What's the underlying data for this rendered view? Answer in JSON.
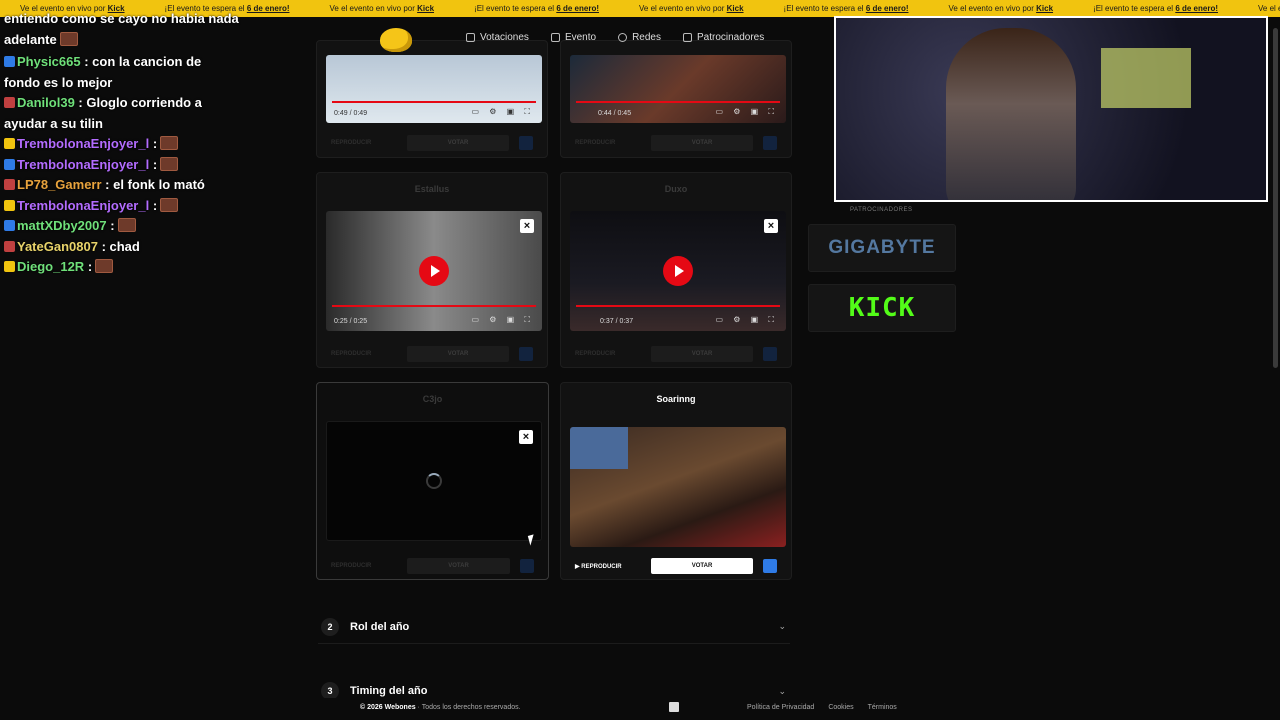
{
  "ticker": {
    "messages": [
      {
        "text": "Ve el evento en vivo por",
        "link": "Kick"
      },
      {
        "text": "¡El evento te espera el",
        "link": "6 de enero!"
      },
      {
        "text": "Ve el evento en vivo por",
        "link": "Kick"
      },
      {
        "text": "¡El evento te espera el",
        "link": "6 de enero!"
      },
      {
        "text": "Ve el evento en vivo por",
        "link": "Kick"
      },
      {
        "text": "¡El evento te espera el",
        "link": "6 de enero!"
      },
      {
        "text": "Ve el evento en vivo por",
        "link": "Kick"
      },
      {
        "text": "¡El evento te espera el",
        "link": "6 de enero!"
      },
      {
        "text": "Ve el evento en vivo por",
        "link": "Kick"
      }
    ]
  },
  "chat": {
    "top_line_1": "entiendo como se cayo no habia nada",
    "top_line_2": "adelante",
    "messages": [
      {
        "user": "Physic665",
        "user_color": "#6fe07a",
        "text": " : con la cancion de fondo es lo mejor"
      },
      {
        "user": "Danilol39",
        "user_color": "#6fe07a",
        "text": " : Gloglo corriendo a ayudar a su tilin"
      },
      {
        "user": "TrembolonaEnjoyer_l",
        "user_color": "#b36cff",
        "text": " :"
      },
      {
        "user": "TrembolonaEnjoyer_l",
        "user_color": "#b36cff",
        "text": " :"
      },
      {
        "user": "LP78_Gamerr",
        "user_color": "#e8a33d",
        "text": " : el fonk lo mató"
      },
      {
        "user": "TrembolonaEnjoyer_l",
        "user_color": "#b36cff",
        "text": " :"
      },
      {
        "user": "mattXDby2007",
        "user_color": "#6fe07a",
        "text": " :"
      },
      {
        "user": "YateGan0807",
        "user_color": "#e8d36a",
        "text": " : chad"
      },
      {
        "user": "Diego_12R",
        "user_color": "#6fe07a",
        "text": " :"
      }
    ]
  },
  "nav": {
    "links": [
      "Votaciones",
      "Evento",
      "Redes",
      "Patrocinadores"
    ]
  },
  "cards": [
    {
      "name": "",
      "time": "0:49 / 0:49",
      "play_label": "REPRODUCIR",
      "vote_label": "VOTAR"
    },
    {
      "name": "",
      "time": "0:44 / 0:45",
      "play_label": "REPRODUCIR",
      "vote_label": "VOTAR"
    },
    {
      "name": "Estallus",
      "time": "0:25 / 0:25",
      "play_label": "REPRODUCIR",
      "vote_label": "VOTAR"
    },
    {
      "name": "Duxo",
      "time": "0:37 / 0:37",
      "play_label": "REPRODUCIR",
      "vote_label": "VOTAR"
    },
    {
      "name": "C3jo",
      "time": "",
      "play_label": "REPRODUCIR",
      "vote_label": "VOTAR"
    },
    {
      "name": "Soarinng",
      "time": "",
      "play_label": "REPRODUCIR",
      "vote_label": "VOTAR"
    }
  ],
  "sections": [
    {
      "num": "2",
      "title": "Rol del año"
    },
    {
      "num": "3",
      "title": "Timing del año"
    }
  ],
  "sponsors": {
    "label": "PATROCINADORES",
    "items": [
      "GIGABYTE",
      "KICK"
    ]
  },
  "footer": {
    "brand": "© 2026 Webones",
    "rights": "Todos los derechos reservados.",
    "links": [
      "Política de Privacidad",
      "Cookies",
      "Términos"
    ]
  }
}
